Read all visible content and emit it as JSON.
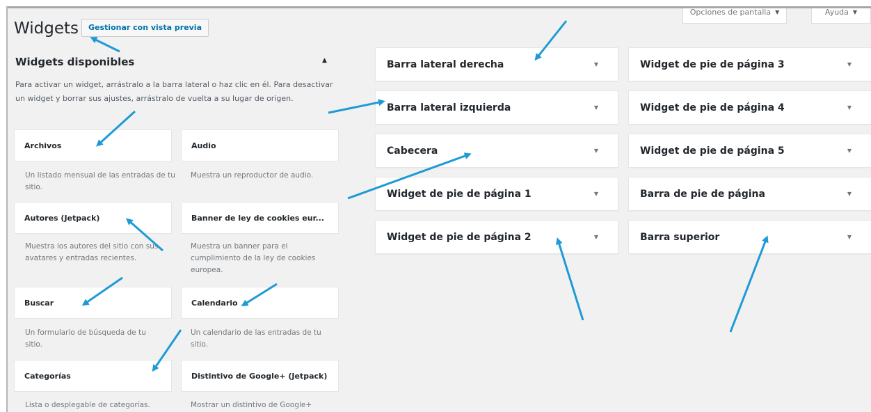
{
  "screen_tabs": {
    "options_label": "Opciones de pantalla",
    "help_label": "Ayuda"
  },
  "header": {
    "title": "Widgets",
    "preview_button": "Gestionar con vista previa"
  },
  "available": {
    "title": "Widgets disponibles",
    "description": "Para activar un widget, arrástralo a la barra lateral o haz clic en él. Para desactivar un widget y borrar sus ajustes, arrástralo de vuelta a su lugar de origen.",
    "widgets": [
      {
        "name": "Archivos",
        "description": "Un listado mensual de las entradas de tu sitio."
      },
      {
        "name": "Audio",
        "description": "Muestra un reproductor de audio."
      },
      {
        "name": "Autores (Jetpack)",
        "description": "Muestra los autores del sitio con sus avatares y entradas recientes."
      },
      {
        "name": "Banner de ley de cookies eur...",
        "description": "Muestra un banner para el cumplimiento de la ley de cookies europea."
      },
      {
        "name": "Buscar",
        "description": "Un formulario de búsqueda de tu sitio."
      },
      {
        "name": "Calendario",
        "description": "Un calendario de las entradas de tu sitio."
      },
      {
        "name": "Categorías",
        "description": "Lista o desplegable de categorías."
      },
      {
        "name": "Distintivo de Google+ (Jetpack)",
        "description": "Mostrar un distintivo de Google+"
      }
    ]
  },
  "widget_areas": {
    "left_column": [
      "Barra lateral derecha",
      "Barra lateral izquierda",
      "Cabecera",
      "Widget de pie de página 1",
      "Widget de pie de página 2"
    ],
    "right_column": [
      "Widget de pie de página 3",
      "Widget de pie de página 4",
      "Widget de pie de página 5",
      "Barra de pie de página",
      "Barra superior"
    ]
  },
  "colors": {
    "annotation_arrow": "#1e9ad6",
    "link_blue": "#0073aa",
    "background": "#f1f1f1"
  }
}
